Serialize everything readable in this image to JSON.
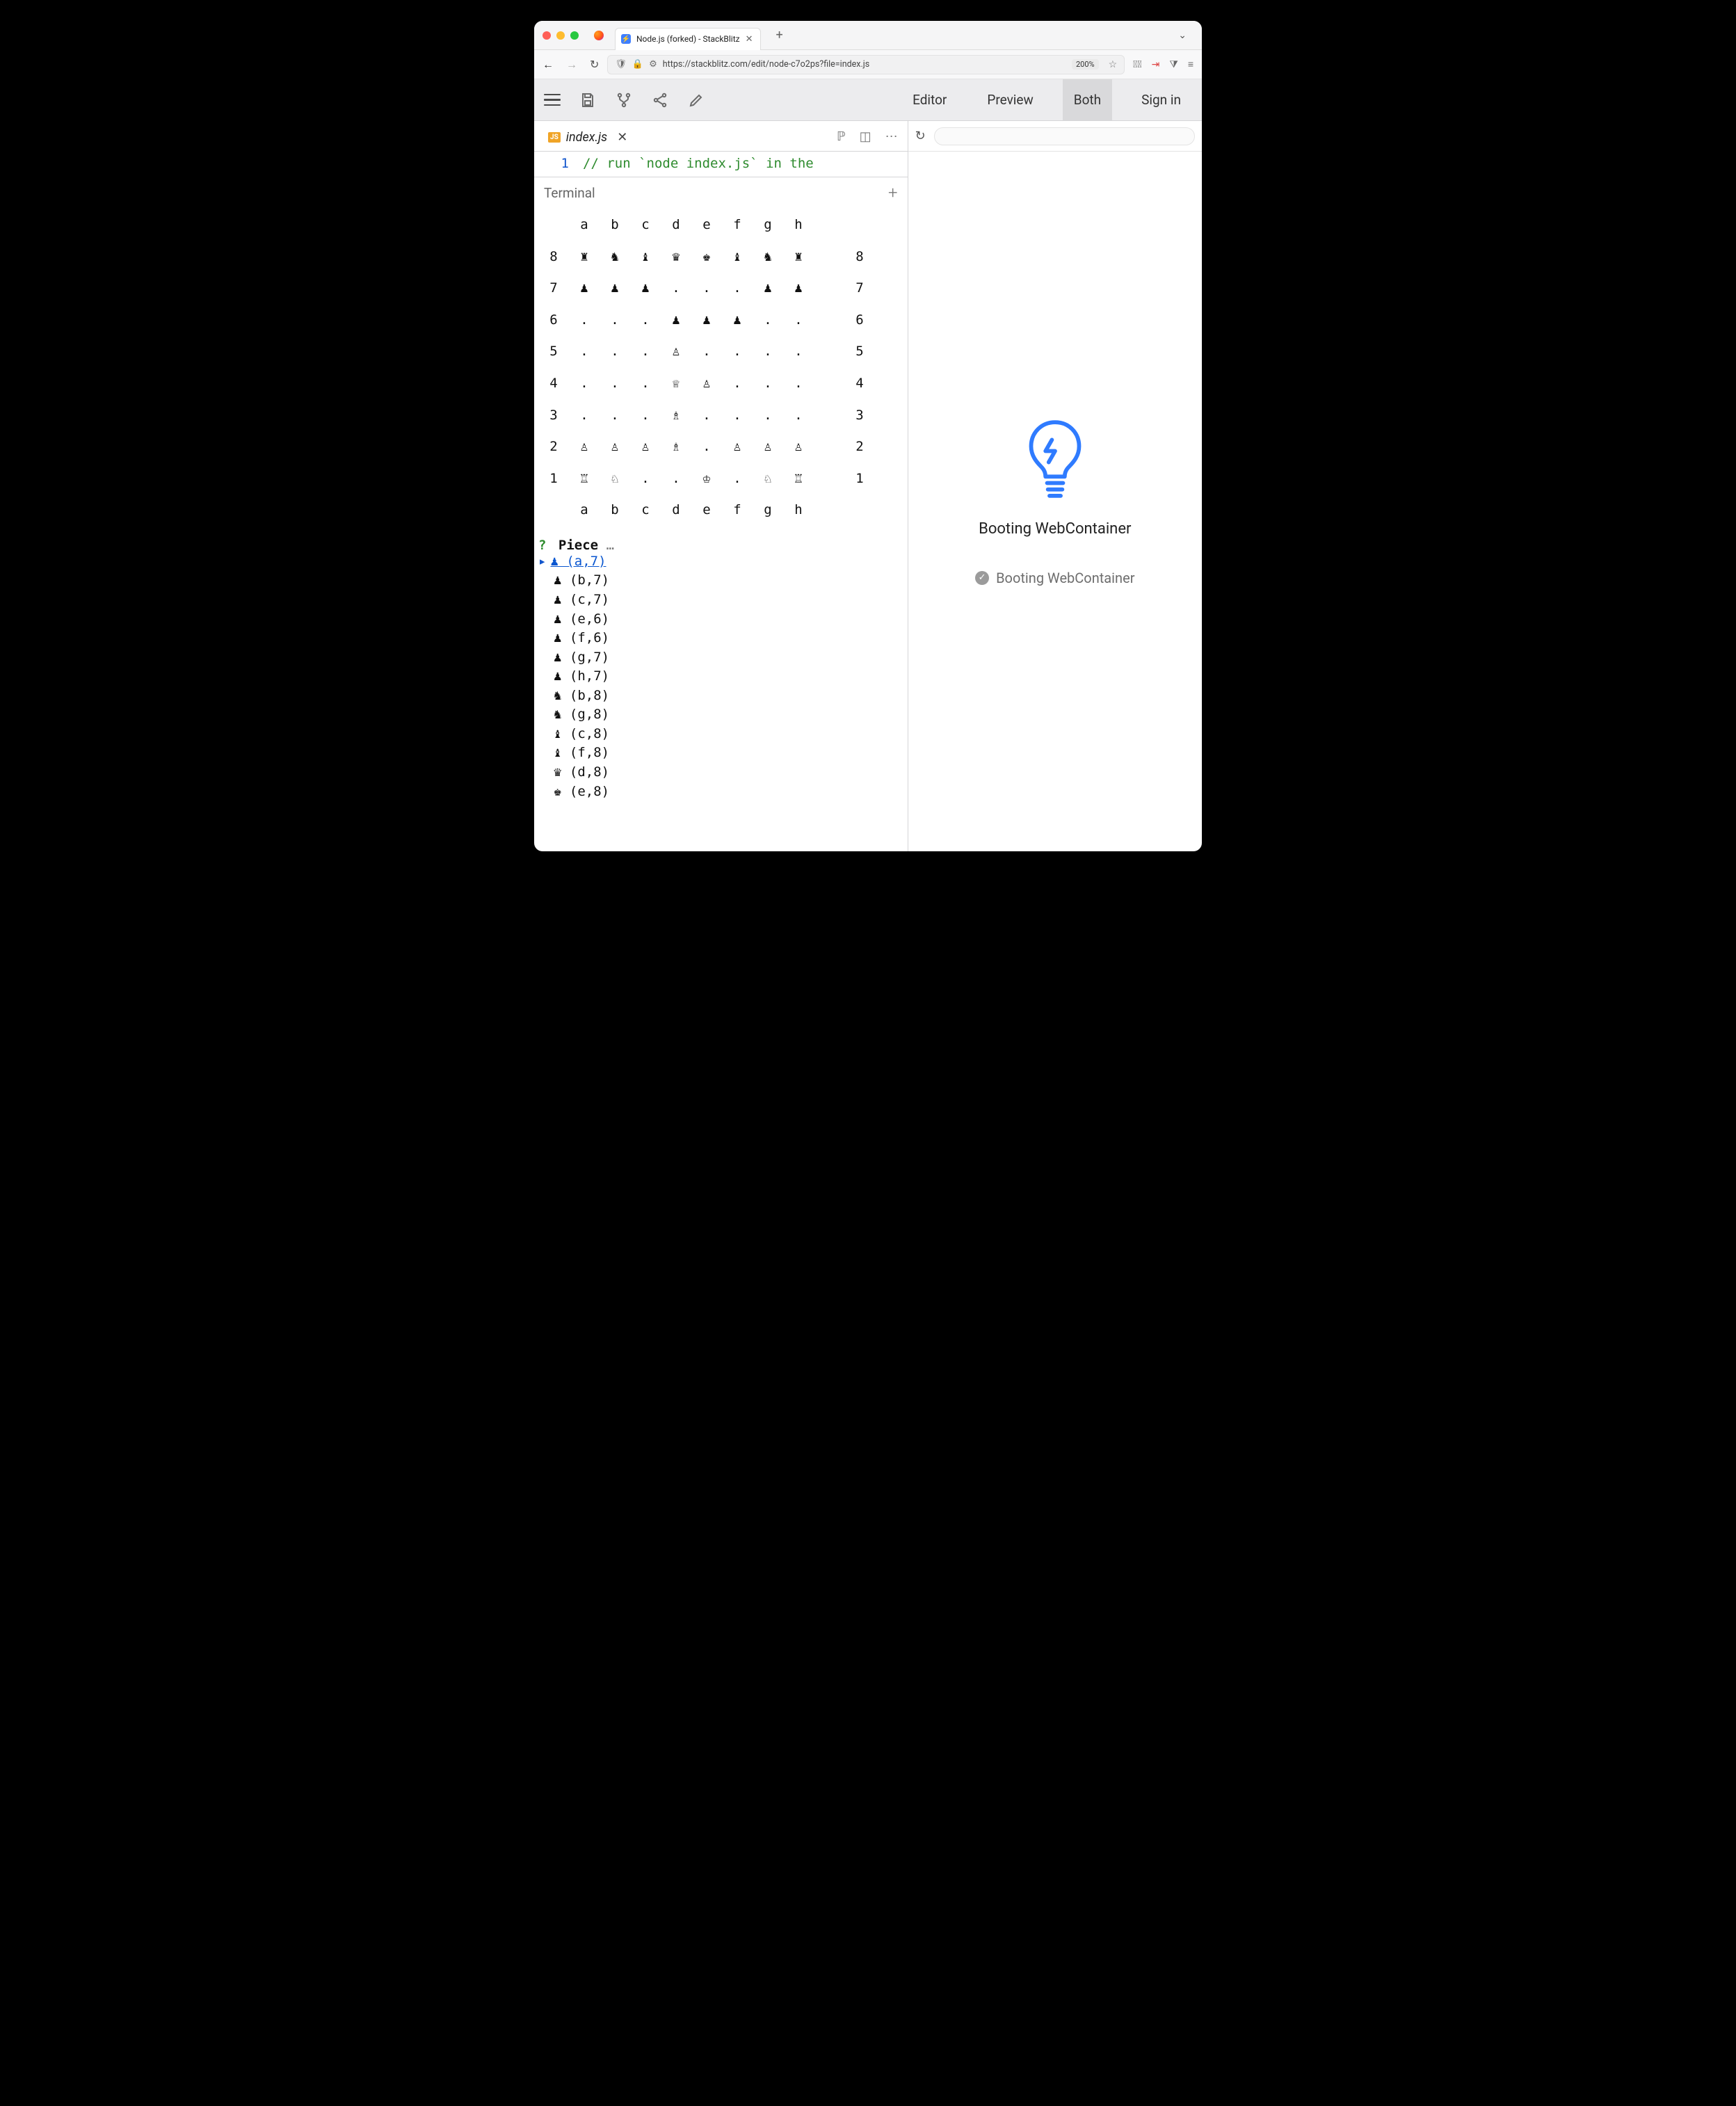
{
  "browser": {
    "tab_title": "Node.js (forked) - StackBlitz",
    "url": "https://stackblitz.com/edit/node-c7o2ps?file=index.js",
    "zoom": "200%"
  },
  "header": {
    "tabs": {
      "editor": "Editor",
      "preview": "Preview",
      "both": "Both",
      "signin": "Sign in"
    },
    "active": "Both"
  },
  "file": {
    "name": "index.js"
  },
  "code": {
    "line1_num": "1",
    "line1": "// run `node index.js` in the"
  },
  "terminal": {
    "title": "Terminal",
    "files": [
      "a",
      "b",
      "c",
      "d",
      "e",
      "f",
      "g",
      "h"
    ],
    "rows": [
      {
        "rank": "8",
        "cells": [
          "♜",
          "♞",
          "♝",
          "♛",
          "♚",
          "♝",
          "♞",
          "♜"
        ]
      },
      {
        "rank": "7",
        "cells": [
          "♟",
          "♟",
          "♟",
          ".",
          ".",
          ".",
          "♟",
          "♟"
        ]
      },
      {
        "rank": "6",
        "cells": [
          ".",
          ".",
          ".",
          "♟",
          "♟",
          "♟",
          ".",
          "."
        ]
      },
      {
        "rank": "5",
        "cells": [
          ".",
          ".",
          ".",
          "♙",
          ".",
          ".",
          ".",
          "."
        ]
      },
      {
        "rank": "4",
        "cells": [
          ".",
          ".",
          ".",
          "♕",
          "♙",
          ".",
          ".",
          "."
        ]
      },
      {
        "rank": "3",
        "cells": [
          ".",
          ".",
          ".",
          "♗",
          ".",
          ".",
          ".",
          "."
        ]
      },
      {
        "rank": "2",
        "cells": [
          "♙",
          "♙",
          "♙",
          "♗",
          ".",
          "♙",
          "♙",
          "♙"
        ]
      },
      {
        "rank": "1",
        "cells": [
          "♖",
          "♘",
          ".",
          ".",
          "♔",
          ".",
          "♘",
          "♖"
        ]
      }
    ],
    "prompt": {
      "q": "?",
      "label": "Piece",
      "dots": "…"
    },
    "options": [
      {
        "sym": "♟",
        "text": "(a,7)",
        "selected": true
      },
      {
        "sym": "♟",
        "text": "(b,7)"
      },
      {
        "sym": "♟",
        "text": "(c,7)"
      },
      {
        "sym": "♟",
        "text": "(e,6)"
      },
      {
        "sym": "♟",
        "text": "(f,6)"
      },
      {
        "sym": "♟",
        "text": "(g,7)"
      },
      {
        "sym": "♟",
        "text": "(h,7)"
      },
      {
        "sym": "♞",
        "text": "(b,8)"
      },
      {
        "sym": "♞",
        "text": "(g,8)"
      },
      {
        "sym": "♝",
        "text": "(c,8)"
      },
      {
        "sym": "♝",
        "text": "(f,8)"
      },
      {
        "sym": "♛",
        "text": "(d,8)"
      },
      {
        "sym": "♚",
        "text": "(e,8)"
      }
    ]
  },
  "preview": {
    "heading": "Booting WebContainer",
    "status": "Booting WebContainer"
  }
}
